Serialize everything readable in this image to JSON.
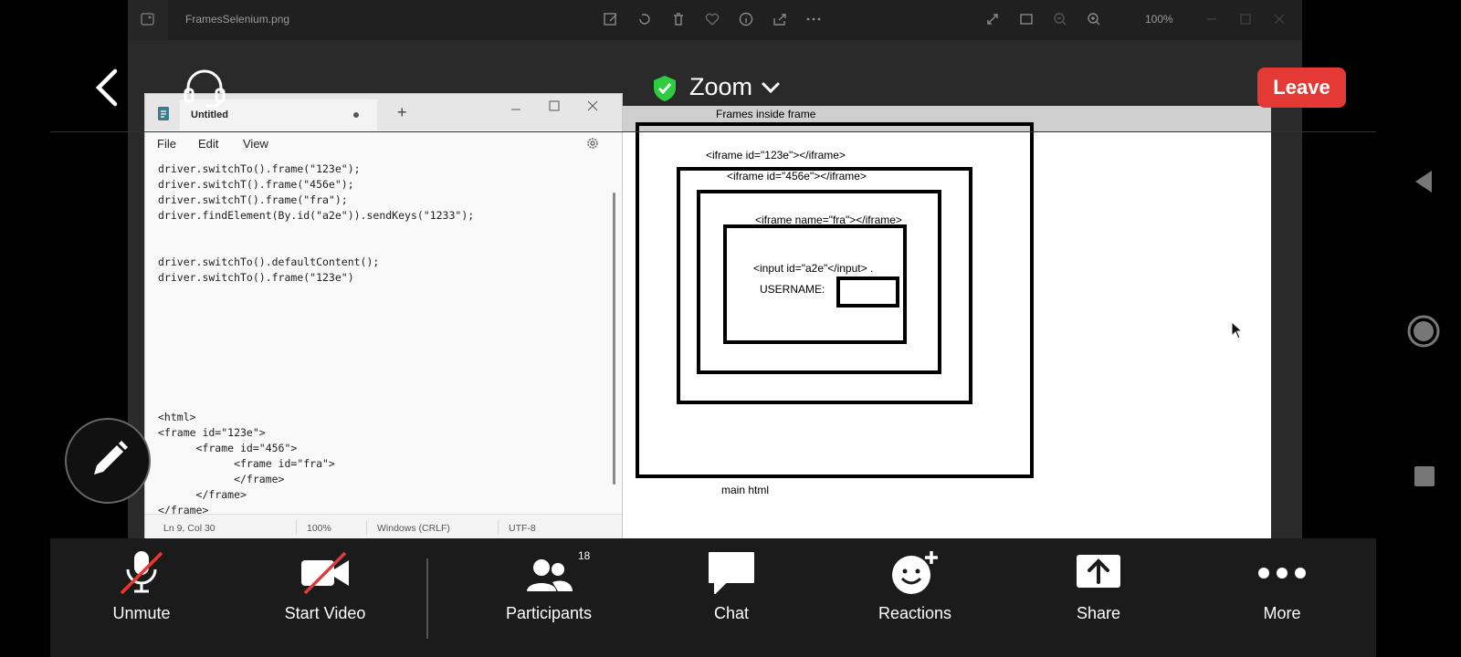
{
  "viewer": {
    "filename": "FramesSelenium.png",
    "zoom": "100%"
  },
  "meeting": {
    "title": "Zoom",
    "leave_label": "Leave"
  },
  "notepad": {
    "tab_title": "Untitled",
    "menu": [
      "File",
      "Edit",
      "View"
    ],
    "content": "driver.switchTo().frame(\"123e\");\ndriver.switchT().frame(\"456e\");\ndriver.switchT().frame(\"fra\");\ndriver.findElement(By.id(\"a2e\")).sendKeys(\"1233\");\n\n\ndriver.switchTo().defaultContent();\ndriver.switchTo().frame(\"123e\")\n\n\n\n\n\n\n\n\n<html>\n<frame id=\"123e\">\n      <frame id=\"456\">\n            <frame id=\"fra\">\n            </frame>\n      </frame>\n</frame>",
    "status": {
      "position": "Ln 9, Col 30",
      "zoom": "100%",
      "line_ending": "Windows (CRLF)",
      "encoding": "UTF-8"
    }
  },
  "diagram": {
    "title": "Frames inside frame",
    "frame1": "<iframe id=\"123e\"></iframe>",
    "frame2": "<iframe id=\"456e\"></iframe>",
    "frame3": "<iframe name=\"fra\"></iframe>",
    "input": "<input id=\"a2e\"</input>   .",
    "username": "USERNAME:",
    "footer": "main html"
  },
  "toolbar": {
    "unmute": "Unmute",
    "start_video": "Start Video",
    "participants": "Participants",
    "participants_count": "18",
    "chat": "Chat",
    "reactions": "Reactions",
    "share": "Share",
    "more": "More"
  },
  "colors": {
    "leave": "#e53935",
    "shield": "#2ecc40",
    "muted_slash": "#e53935"
  }
}
